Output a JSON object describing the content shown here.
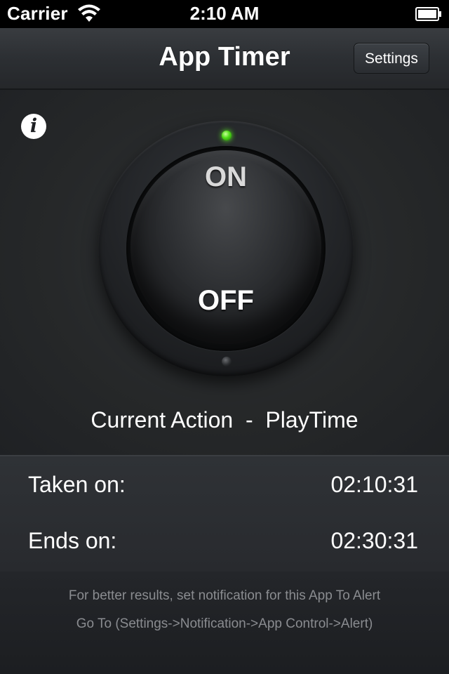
{
  "status_bar": {
    "carrier": "Carrier",
    "time": "2:10 AM",
    "icons": [
      "wifi-icon",
      "battery-icon"
    ]
  },
  "nav": {
    "title": "App Timer",
    "settings_label": "Settings"
  },
  "info": {
    "icon": "info-icon",
    "glyph": "i"
  },
  "switch": {
    "on_label": "ON",
    "off_label": "OFF",
    "state": "off",
    "indicator_on_color": "#4fdc18"
  },
  "current_action": {
    "text": "Current Action  -  PlayTime"
  },
  "times": {
    "taken_label": "Taken on:",
    "taken_value": "02:10:31",
    "ends_label": "Ends on:",
    "ends_value": "02:30:31"
  },
  "footer": {
    "line1": "For better results, set notification for this App To Alert",
    "line2": "Go To (Settings->Notification->App Control->Alert)"
  }
}
